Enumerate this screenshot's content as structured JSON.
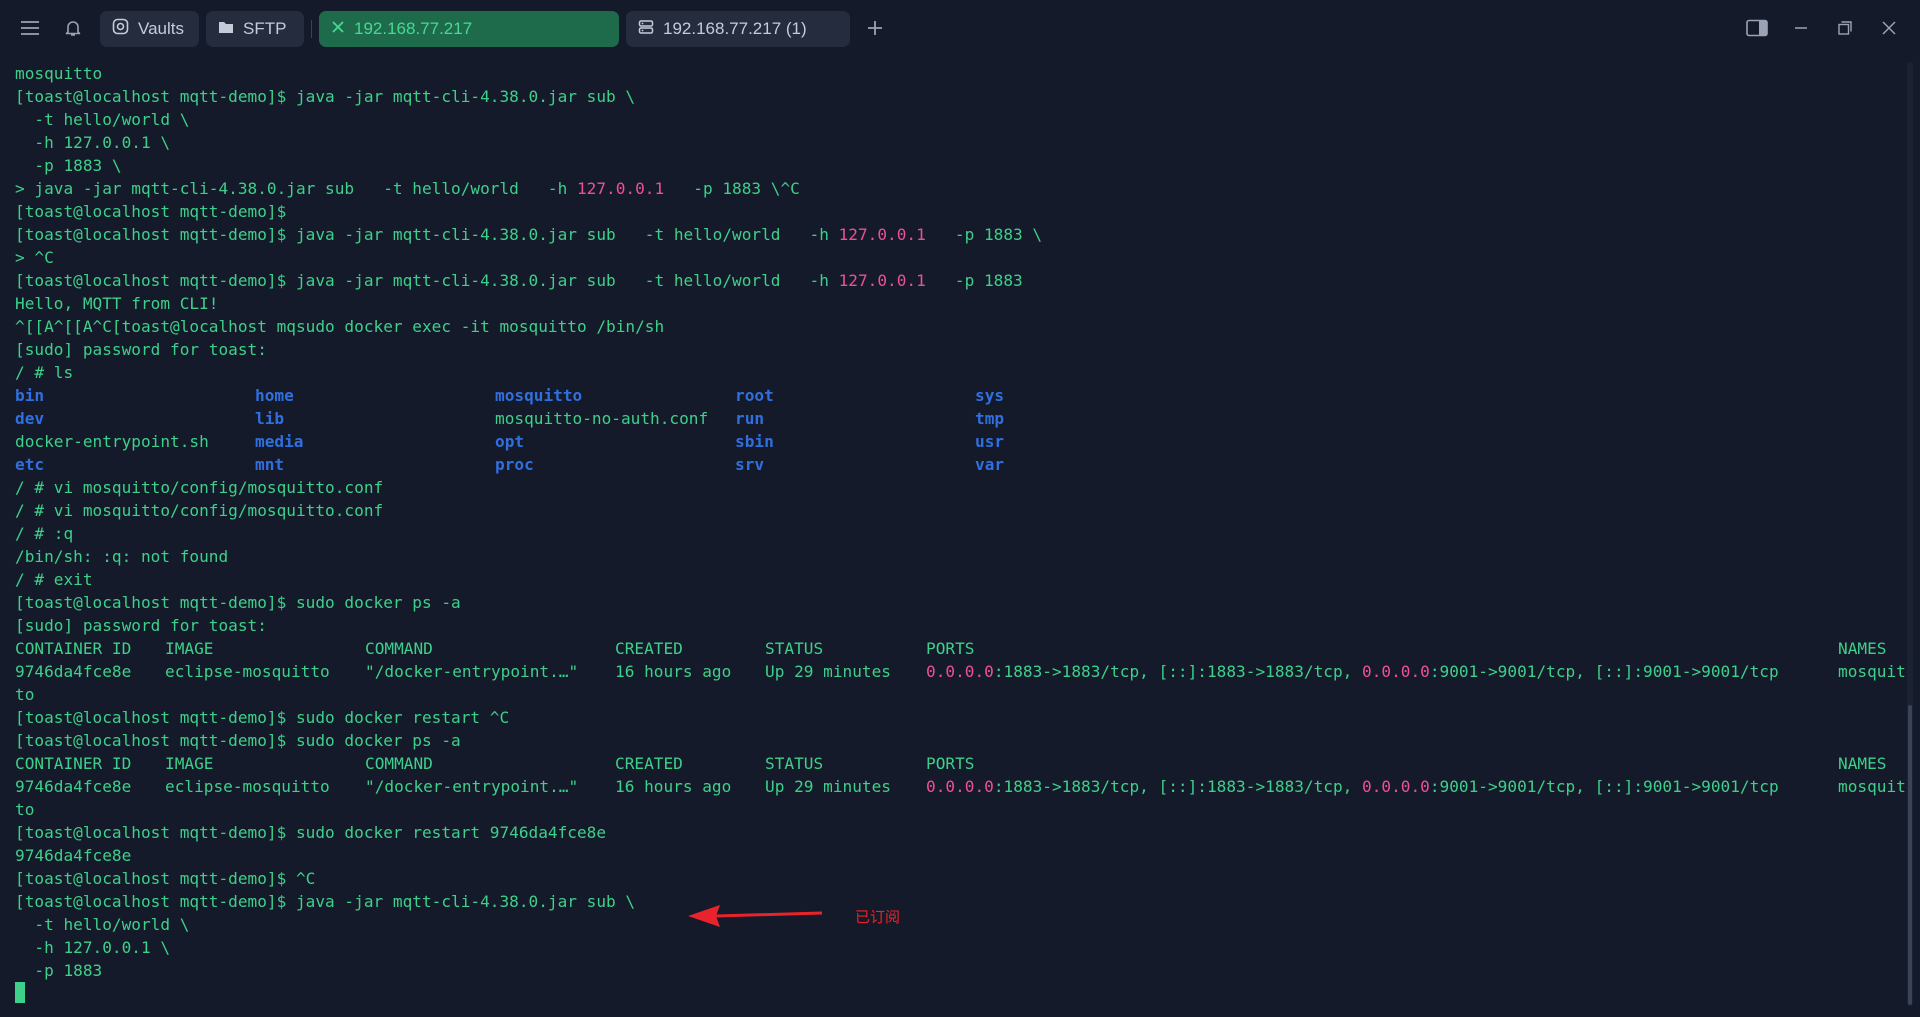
{
  "tabs": {
    "vaults": "Vaults",
    "sftp": "SFTP",
    "host_active": "192.168.77.217",
    "host_second": "192.168.77.217 (1)"
  },
  "icons": [
    "menu-icon",
    "bell-icon",
    "vault-icon",
    "folder-icon",
    "close-icon",
    "server-icon",
    "plus-icon",
    "split-view-icon",
    "minimize-icon",
    "restore-icon",
    "close-window-icon"
  ],
  "colors": {
    "prompt_green": "#3ed08a",
    "ip_pink": "#ee4f9a",
    "dir_blue": "#2f6fe0",
    "active_tab_bg": "#1e6b4c",
    "annotation_red": "#e8232b"
  },
  "terminal": {
    "lines": [
      {
        "segments": [
          "mosquitto"
        ]
      },
      {
        "segments": [
          "[toast@localhost mqtt-demo]$ java -jar mqtt-cli-4.38.0.jar sub \\"
        ]
      },
      {
        "segments": [
          "  -t hello/world \\"
        ]
      },
      {
        "segments": [
          "  -h 127.0.0.1 \\"
        ]
      },
      {
        "segments": [
          "  -p 1883 \\"
        ]
      },
      {
        "segments": [
          "> java -jar mqtt-cli-4.38.0.jar sub   -t hello/world   -h ",
          {
            "text": "127.0.0.1",
            "color": "pink"
          },
          "   -p 1883 \\^C"
        ]
      },
      {
        "segments": [
          "[toast@localhost mqtt-demo]$"
        ]
      },
      {
        "segments": [
          "[toast@localhost mqtt-demo]$ java -jar mqtt-cli-4.38.0.jar sub   -t hello/world   -h ",
          {
            "text": "127.0.0.1",
            "color": "pink"
          },
          "   -p 1883 \\"
        ]
      },
      {
        "segments": [
          "> ^C"
        ]
      },
      {
        "segments": [
          "[toast@localhost mqtt-demo]$ java -jar mqtt-cli-4.38.0.jar sub   -t hello/world   -h ",
          {
            "text": "127.0.0.1",
            "color": "pink"
          },
          "   -p 1883"
        ]
      },
      {
        "segments": [
          "Hello, MQTT from CLI!"
        ]
      },
      {
        "segments": [
          "^[[A^[[A^C[toast@localhost mqsudo docker exec -it mosquitto /bin/sh"
        ]
      },
      {
        "segments": [
          "[sudo] password for toast:"
        ]
      },
      {
        "segments": [
          "/ # ls"
        ]
      },
      {
        "ls": [
          {
            "name": "bin",
            "dir": true
          },
          {
            "name": "home",
            "dir": true
          },
          {
            "name": "mosquitto",
            "dir": true
          },
          {
            "name": "root",
            "dir": true
          },
          {
            "name": "sys",
            "dir": true
          }
        ]
      },
      {
        "ls": [
          {
            "name": "dev",
            "dir": true
          },
          {
            "name": "lib",
            "dir": true
          },
          {
            "name": "mosquitto-no-auth.conf",
            "dir": false
          },
          {
            "name": "run",
            "dir": true
          },
          {
            "name": "tmp",
            "dir": true
          }
        ]
      },
      {
        "ls": [
          {
            "name": "docker-entrypoint.sh",
            "dir": false
          },
          {
            "name": "media",
            "dir": true
          },
          {
            "name": "opt",
            "dir": true
          },
          {
            "name": "sbin",
            "dir": true
          },
          {
            "name": "usr",
            "dir": true
          }
        ]
      },
      {
        "ls": [
          {
            "name": "etc",
            "dir": true
          },
          {
            "name": "mnt",
            "dir": true
          },
          {
            "name": "proc",
            "dir": true
          },
          {
            "name": "srv",
            "dir": true
          },
          {
            "name": "var",
            "dir": true
          }
        ]
      },
      {
        "segments": [
          "/ # vi mosquitto/config/mosquitto.conf"
        ]
      },
      {
        "segments": [
          "/ # vi mosquitto/config/mosquitto.conf"
        ]
      },
      {
        "segments": [
          "/ # :q"
        ]
      },
      {
        "segments": [
          "/bin/sh: :q: not found"
        ]
      },
      {
        "segments": [
          "/ # exit"
        ]
      },
      {
        "segments": [
          "[toast@localhost mqtt-demo]$ sudo docker ps -a"
        ]
      },
      {
        "segments": [
          "[sudo] password for toast:"
        ]
      },
      {
        "cols": [
          "CONTAINER ID",
          "IMAGE",
          "COMMAND",
          "CREATED",
          "STATUS",
          [
            "PORTS"
          ],
          "NAMES"
        ]
      },
      {
        "cols": [
          "9746da4fce8e",
          "eclipse-mosquitto",
          "\"/docker-entrypoint.…\"",
          "16 hours ago",
          "Up 29 minutes",
          [
            {
              "text": "0.0.0.0",
              "color": "pink"
            },
            ":1883->1883/tcp, [::]:1883->1883/tcp, ",
            {
              "text": "0.0.0.0",
              "color": "pink"
            },
            ":9001->9001/tcp, [::]:9001->9001/tcp"
          ],
          "mosquit"
        ]
      },
      {
        "segments": [
          "to"
        ]
      },
      {
        "segments": [
          "[toast@localhost mqtt-demo]$ sudo docker restart ^C"
        ]
      },
      {
        "segments": [
          "[toast@localhost mqtt-demo]$ sudo docker ps -a"
        ]
      },
      {
        "cols": [
          "CONTAINER ID",
          "IMAGE",
          "COMMAND",
          "CREATED",
          "STATUS",
          [
            "PORTS"
          ],
          "NAMES"
        ]
      },
      {
        "cols": [
          "9746da4fce8e",
          "eclipse-mosquitto",
          "\"/docker-entrypoint.…\"",
          "16 hours ago",
          "Up 29 minutes",
          [
            {
              "text": "0.0.0.0",
              "color": "pink"
            },
            ":1883->1883/tcp, [::]:1883->1883/tcp, ",
            {
              "text": "0.0.0.0",
              "color": "pink"
            },
            ":9001->9001/tcp, [::]:9001->9001/tcp"
          ],
          "mosquit"
        ]
      },
      {
        "segments": [
          "to"
        ]
      },
      {
        "segments": [
          "[toast@localhost mqtt-demo]$ sudo docker restart 9746da4fce8e"
        ]
      },
      {
        "segments": [
          "9746da4fce8e"
        ]
      },
      {
        "segments": [
          "[toast@localhost mqtt-demo]$ ^C"
        ]
      },
      {
        "segments": [
          "[toast@localhost mqtt-demo]$ java -jar mqtt-cli-4.38.0.jar sub \\"
        ]
      },
      {
        "segments": [
          "  -t hello/world \\"
        ]
      },
      {
        "segments": [
          "  -h 127.0.0.1 \\"
        ]
      },
      {
        "segments": [
          "  -p 1883"
        ]
      },
      {
        "cursor": true
      }
    ]
  },
  "annotation": {
    "text": "已订阅"
  }
}
